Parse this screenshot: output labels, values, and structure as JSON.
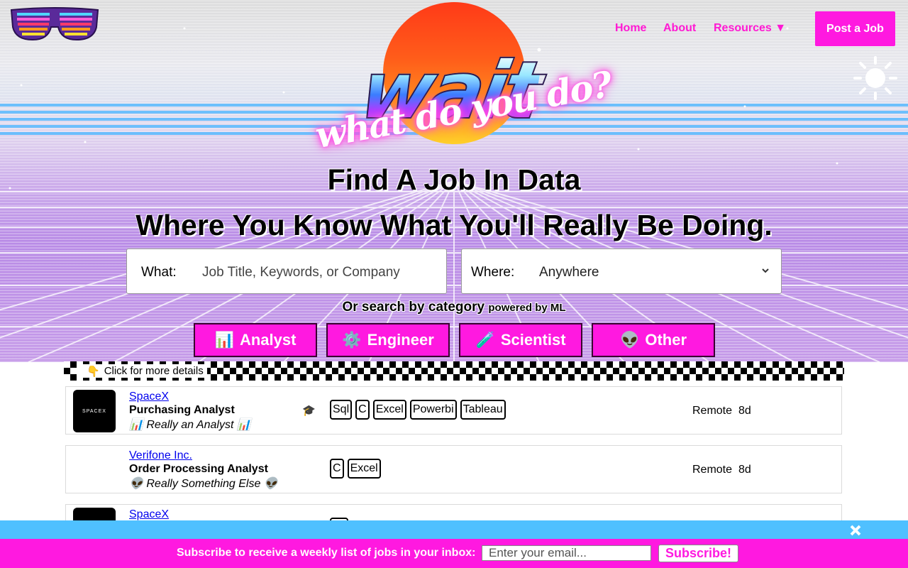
{
  "header": {
    "nav": [
      {
        "label": "Home"
      },
      {
        "label": "About"
      },
      {
        "label": "Resources ▼"
      }
    ],
    "post_job_label": "Post a Job"
  },
  "hero": {
    "wordmark_main": "wait",
    "wordmark_sub": "what do you do?",
    "heading": "Find A Job In Data",
    "subheading": "Where You Know What You'll Really Be Doing."
  },
  "search": {
    "what_label": "What:",
    "what_placeholder": "Job Title, Keywords, or Company",
    "where_label": "Where:",
    "where_value": "Anywhere"
  },
  "categories": {
    "heading": "Or search by category",
    "heading_small": "powered by ML",
    "buttons": [
      {
        "icon": "📊",
        "label": "Analyst"
      },
      {
        "icon": "⚙️",
        "label": "Engineer"
      },
      {
        "icon": "🧪",
        "label": "Scientist"
      },
      {
        "icon": "👽",
        "label": "Other"
      }
    ]
  },
  "list_hint": {
    "icon": "👇",
    "text": "Click for more details"
  },
  "jobs": [
    {
      "company": "SpaceX",
      "title": "Purchasing Analyst",
      "reality": "📊 Really an Analyst 📊",
      "logo_text": "SPACEX",
      "has_logo": true,
      "edu_icon": "🎓",
      "tags": [
        "Sql",
        "C",
        "Excel",
        "Powerbi",
        "Tableau"
      ],
      "location": "Remote",
      "age": "8d"
    },
    {
      "company": "Verifone Inc.",
      "title": "Order Processing Analyst",
      "reality": "👽 Really Something Else 👽",
      "has_logo": false,
      "tags": [
        "C",
        "Excel"
      ],
      "location": "Remote",
      "age": "8d"
    },
    {
      "company": "SpaceX",
      "has_logo": true
    }
  ],
  "subscribe": {
    "text": "Subscribe to receive a weekly list of jobs in your inbox:",
    "placeholder": "Enter your email...",
    "button": "Subscribe!"
  },
  "colors": {
    "accent": "#ff19e0",
    "link": "#0000ee",
    "strip": "#4fc0ff"
  }
}
